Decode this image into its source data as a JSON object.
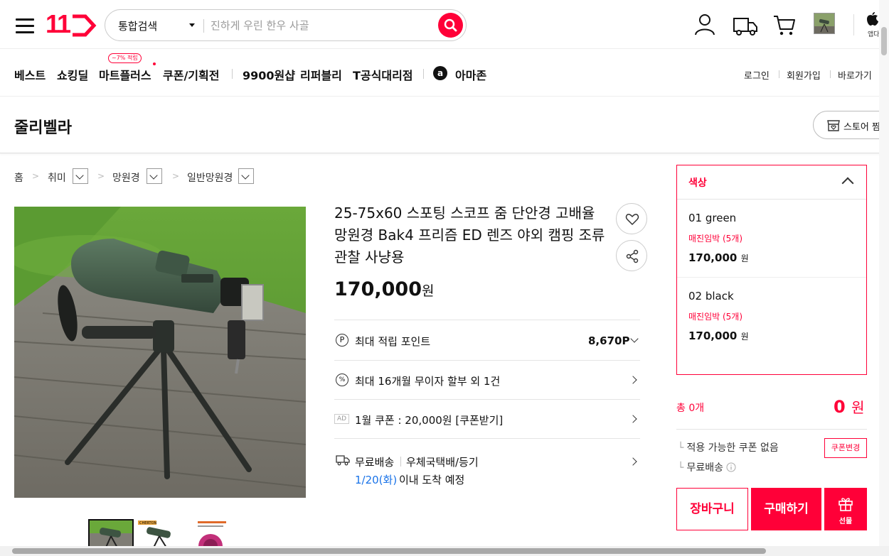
{
  "header": {
    "logo_text": "11",
    "search": {
      "type_label": "통합검색",
      "placeholder": "진하게 우린 한우 사골"
    },
    "app_label": "앱다"
  },
  "nav": {
    "items": [
      "베스트",
      "쇼킹딜",
      "마트플러스",
      "쿠폰/기획전",
      "9900원샵",
      "리퍼블리",
      "T공식대리점",
      "아마존"
    ],
    "badge": "~7% 적립",
    "amazon_letter": "a",
    "util": [
      "로그인",
      "회원가입",
      "바로가기"
    ]
  },
  "store": {
    "name": "줄리벨라",
    "button_label": "스토어 찜"
  },
  "breadcrumb": [
    "홈",
    "취미",
    "망원경",
    "일반망원경"
  ],
  "product": {
    "title": "25-75x60 스포팅 스코프 줌 단안경 고배율 망원경 Bak4 프리즘 ED 렌즈 야외 캠핑 조류 관찰 사냥용",
    "price": "170,000",
    "currency": "원",
    "points_label": "최대 적립 포인트",
    "points_value": "8,670P",
    "points_icon_letter": "P",
    "installment_icon": "%",
    "installment": "최대 16개월 무이자 할부 외 1건",
    "ad_label": "AD",
    "coupon": "1월 쿠폰 : 20,000원 [쿠폰받기]",
    "shipping_label": "무료배송",
    "shipping_method": "우체국택배/등기",
    "arrival_date": "1/20(화)",
    "arrival_suffix": "이내 도착 예정",
    "thumb_text": "CHERTON"
  },
  "options": {
    "label": "색상",
    "items": [
      {
        "name": "01 green",
        "stock": "매진임박 (5개)",
        "price": "170,000",
        "won": "원"
      },
      {
        "name": "02 black",
        "stock": "매진임박 (5개)",
        "price": "170,000",
        "won": "원"
      }
    ]
  },
  "summary": {
    "total_label": "총 0개",
    "total_value": "0",
    "total_won": "원",
    "coupon_status": "적용 가능한 쿠폰 없음",
    "coupon_button": "쿠폰변경",
    "shipping": "무료배송",
    "cart_button": "장바구니",
    "buy_button": "구매하기",
    "gift_button": "선물"
  },
  "colors": {
    "accent": "#ff0038",
    "link_blue": "#1a73e8"
  }
}
